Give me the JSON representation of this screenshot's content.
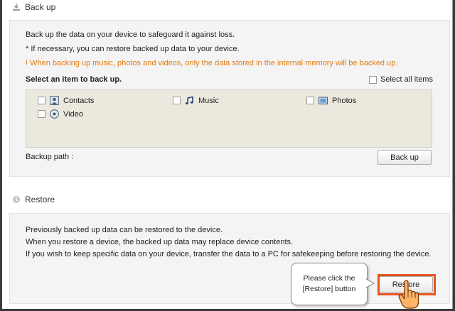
{
  "backup": {
    "title": "Back up",
    "desc1": "Back up the data on your device to safeguard it against loss.",
    "desc2": "* If necessary, you can restore backed up data to your device.",
    "warning": "! When backing up music, photos and videos, only the data stored in the internal memory will be backed up.",
    "select_label": "Select an item to back up.",
    "select_all_label": "Select all items",
    "items": [
      {
        "label": "Contacts",
        "icon": "contacts-icon"
      },
      {
        "label": "Music",
        "icon": "music-icon"
      },
      {
        "label": "Photos",
        "icon": "photos-icon"
      },
      {
        "label": "Video",
        "icon": "video-icon"
      }
    ],
    "path_label": "Backup path :",
    "button_label": "Back up"
  },
  "restore": {
    "title": "Restore",
    "desc1": "Previously backed up data can be restored to the device.",
    "desc2": "When you restore a device, the backed up data may replace device contents.",
    "desc3": "If you wish to keep specific data on your device, transfer the data to a PC for safekeeping before restoring the device.",
    "button_label": "Restore"
  },
  "callout": {
    "line1": "Please click the",
    "line2": "[Restore] button"
  },
  "colors": {
    "warning": "#e07a10",
    "highlight": "#e8541c",
    "items_bg": "#ebe8dd"
  }
}
